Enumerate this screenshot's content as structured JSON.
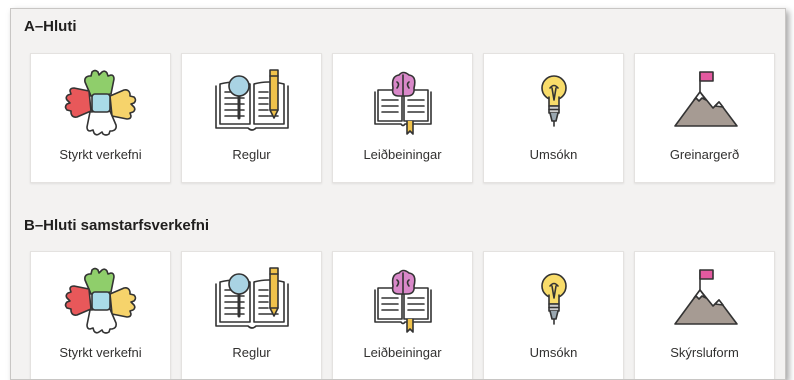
{
  "sections": [
    {
      "title": "A–Hluti",
      "cards": [
        {
          "label": "Styrkt verkefni",
          "icon": "hands-circle-icon"
        },
        {
          "label": "Reglur",
          "icon": "book-magnifier-pencil-icon"
        },
        {
          "label": "Leiðbeiningar",
          "icon": "book-brain-icon"
        },
        {
          "label": "Umsókn",
          "icon": "lightbulb-icon"
        },
        {
          "label": "Greinargerð",
          "icon": "mountain-flag-icon"
        }
      ]
    },
    {
      "title": "B–Hluti samstarfsverkefni",
      "cards": [
        {
          "label": "Styrkt verkefni",
          "icon": "hands-circle-icon"
        },
        {
          "label": "Reglur",
          "icon": "book-magnifier-pencil-icon"
        },
        {
          "label": "Leiðbeiningar",
          "icon": "book-brain-icon"
        },
        {
          "label": "Umsókn",
          "icon": "lightbulb-icon"
        },
        {
          "label": "Skýrsluform",
          "icon": "mountain-flag-icon"
        }
      ]
    }
  ]
}
